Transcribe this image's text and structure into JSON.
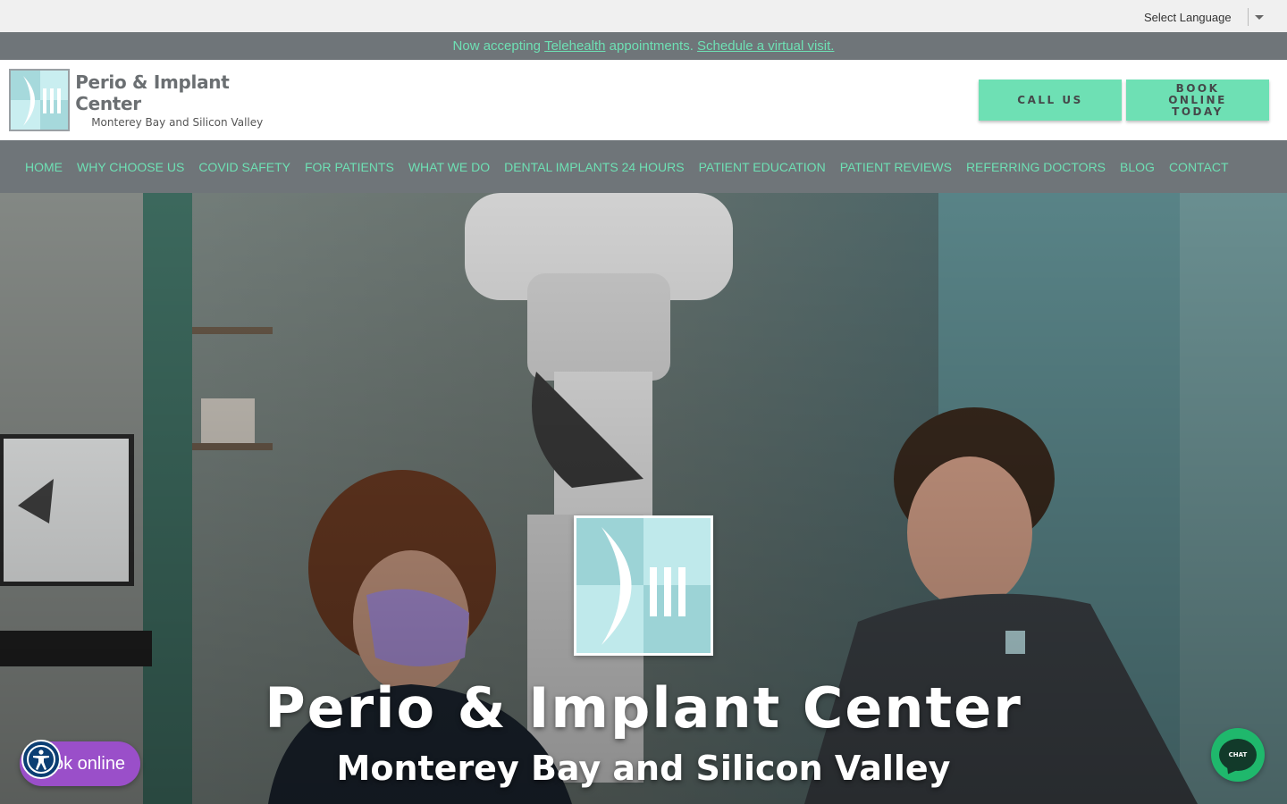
{
  "language": {
    "label": "Select Language"
  },
  "announcement": {
    "prefix": "Now accepting ",
    "telehealth_link": "Telehealth",
    "middle": " appointments. ",
    "schedule_link": "Schedule a virtual visit."
  },
  "header": {
    "logo_title": "Perio & Implant Center",
    "logo_subtitle": "Monterey Bay and Silicon Valley",
    "call_button": "CALL US",
    "book_button": "BOOK ONLINE TODAY"
  },
  "nav": {
    "items": [
      {
        "label": "HOME"
      },
      {
        "label": "WHY CHOOSE US"
      },
      {
        "label": "COVID SAFETY"
      },
      {
        "label": "FOR PATIENTS"
      },
      {
        "label": "WHAT WE DO"
      },
      {
        "label": "DENTAL IMPLANTS 24 HOURS"
      },
      {
        "label": "PATIENT EDUCATION"
      },
      {
        "label": "PATIENT REVIEWS"
      },
      {
        "label": "REFERRING DOCTORS"
      },
      {
        "label": "BLOG"
      },
      {
        "label": "CONTACT"
      }
    ]
  },
  "hero": {
    "title": "Perio & Implant Center",
    "subtitle": "Monterey Bay and Silicon Valley"
  },
  "widgets": {
    "book_online": "ok online",
    "chat": "CHAT",
    "accessibility_icon": "accessibility-icon",
    "chat_icon": "chat-bubble-icon"
  },
  "colors": {
    "accent": "#6ee0b4",
    "bar": "#6f7579",
    "book_pill": "#9a4fc9",
    "chat": "#1fb86c"
  }
}
